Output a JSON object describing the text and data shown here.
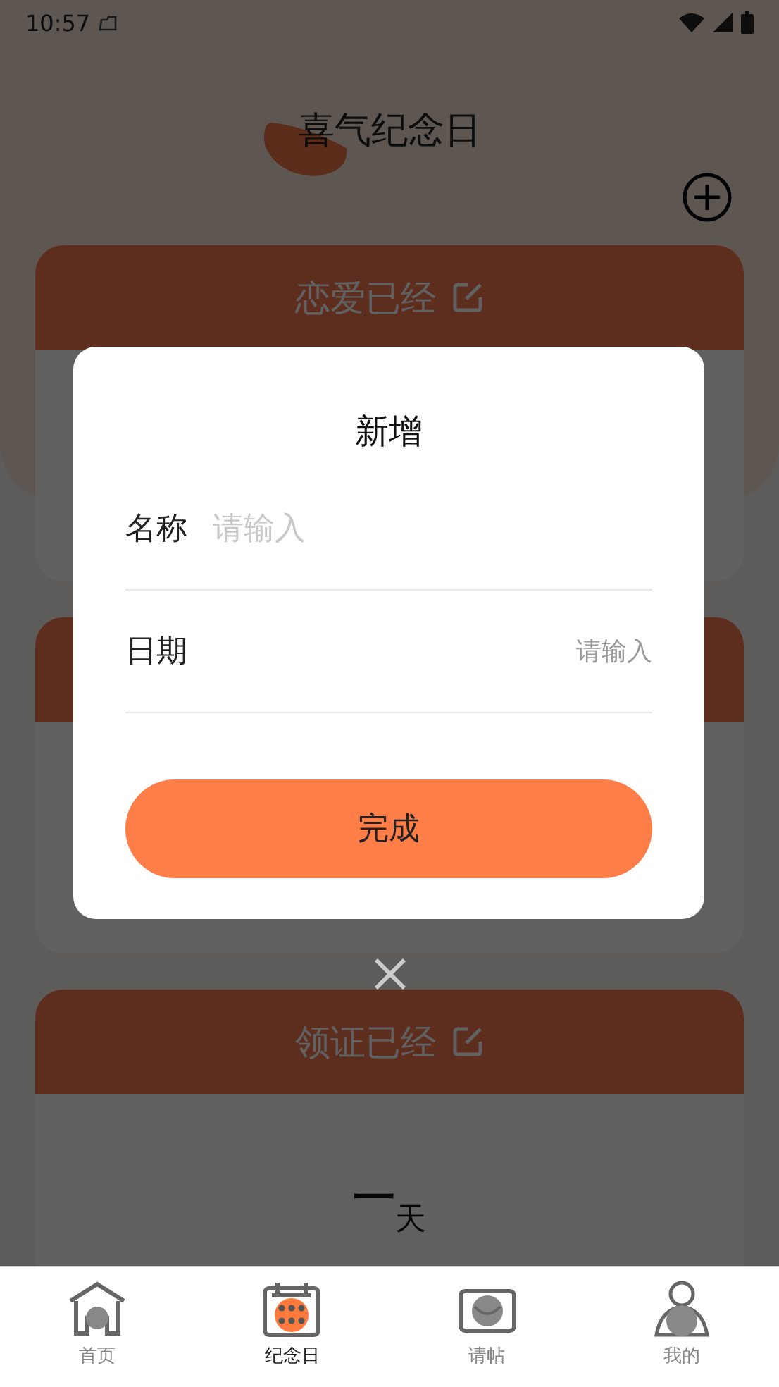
{
  "status_bar": {
    "time": "10:57"
  },
  "header": {
    "title": "喜气纪念日"
  },
  "cards": [
    {
      "kind": "titled",
      "title": "恋爱已经"
    },
    {
      "kind": "covered"
    },
    {
      "kind": "titled",
      "title": "领证已经",
      "days": "一",
      "unit": "天"
    }
  ],
  "dialog": {
    "title": "新增",
    "fields": [
      {
        "label": "名称",
        "placeholder": "请输入",
        "kind": "text"
      },
      {
        "label": "日期",
        "placeholder": "请输入",
        "kind": "date"
      }
    ],
    "button": "完成"
  },
  "tabs": [
    {
      "label": "首页",
      "selected": false,
      "kind": "home"
    },
    {
      "label": "纪念日",
      "selected": true,
      "kind": "calendar"
    },
    {
      "label": "请帖",
      "selected": false,
      "kind": "invite"
    },
    {
      "label": "我的",
      "selected": false,
      "kind": "profile"
    }
  ]
}
